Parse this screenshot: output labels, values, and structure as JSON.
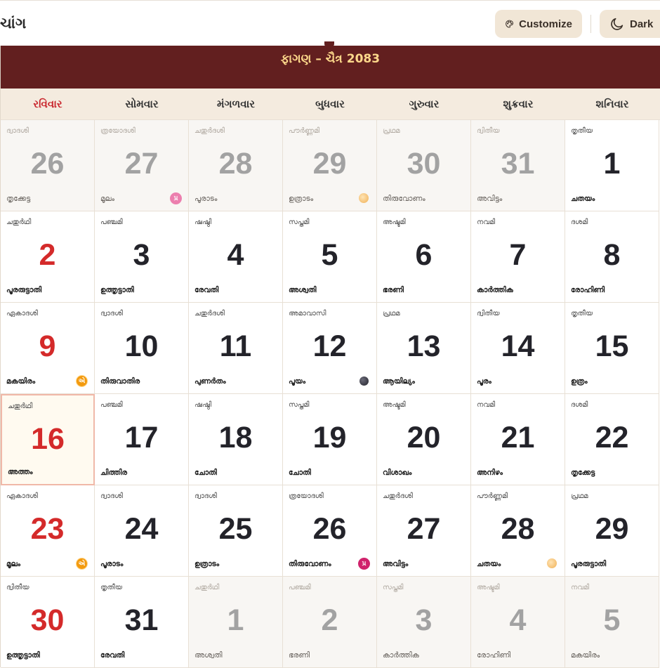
{
  "header": {
    "app_title": "ચાંગ",
    "customize_label": "Customize",
    "dark_label": "Dark",
    "customize_icon": "palette-icon",
    "dark_icon": "moon-icon"
  },
  "calendar": {
    "month_title": "ફાગણ – ચૈત્ર 2083",
    "weekdays": [
      "રવિવાર",
      "સોમવાર",
      "મંગળવાર",
      "બુધવાર",
      "ગુરુવાર",
      "શુક્રવાર",
      "શનિવાર"
    ],
    "days": [
      {
        "num": "26",
        "tithi": "ദ്വാദശി",
        "nak": "തൃക്കേട്ട",
        "muted": true
      },
      {
        "num": "27",
        "tithi": "ത്രയോദശി",
        "nak": "മൂലം",
        "muted": true,
        "marker": "badge-pink",
        "marker_text": "પ્ર"
      },
      {
        "num": "28",
        "tithi": "ചതുർദശി",
        "nak": "പൂരാടം",
        "muted": true
      },
      {
        "num": "29",
        "tithi": "പൗർണ്ണമി",
        "nak": "ഉത്രാടം",
        "muted": true,
        "marker": "full-moon"
      },
      {
        "num": "30",
        "tithi": "പ്രഥമ",
        "nak": "തിരുവോണം",
        "muted": true
      },
      {
        "num": "31",
        "tithi": "ദ്വിതീയ",
        "nak": "അവിട്ടം",
        "muted": true
      },
      {
        "num": "1",
        "tithi": "തൃതീയ",
        "nak": "ചതയം"
      },
      {
        "num": "2",
        "tithi": "ചതുർഥി",
        "nak": "പൂരരുട്ടാതി"
      },
      {
        "num": "3",
        "tithi": "പഞ്ചമി",
        "nak": "ഉത്തൃട്ടാതി"
      },
      {
        "num": "4",
        "tithi": "ഷഷ്ഠി",
        "nak": "രേവതി"
      },
      {
        "num": "5",
        "tithi": "സപ്തമി",
        "nak": "അശ്വതി"
      },
      {
        "num": "6",
        "tithi": "അഷ്ടമി",
        "nak": "ഭരണി"
      },
      {
        "num": "7",
        "tithi": "നവമി",
        "nak": "കാർത്തിക"
      },
      {
        "num": "8",
        "tithi": "ദശമി",
        "nak": "രോഹിണി"
      },
      {
        "num": "9",
        "tithi": "ഏകാദശി",
        "nak": "മകയിരം",
        "marker": "badge-orange",
        "marker_text": "એ"
      },
      {
        "num": "10",
        "tithi": "ദ്വാദശി",
        "nak": "തിരുവാതിര"
      },
      {
        "num": "11",
        "tithi": "ചതുർദശി",
        "nak": "പുണർതം"
      },
      {
        "num": "12",
        "tithi": "അമാവാസി",
        "nak": "പൂയം",
        "marker": "new-moon"
      },
      {
        "num": "13",
        "tithi": "പ്രഥമ",
        "nak": "ആയില്യം"
      },
      {
        "num": "14",
        "tithi": "ദ്വിതീയ",
        "nak": "പൂരം"
      },
      {
        "num": "15",
        "tithi": "തൃതീയ",
        "nak": "ഉത്രം"
      },
      {
        "num": "16",
        "tithi": "ചതുർഥി",
        "nak": "അത്തം",
        "today": true
      },
      {
        "num": "17",
        "tithi": "പഞ്ചമി",
        "nak": "ചിത്തിര"
      },
      {
        "num": "18",
        "tithi": "ഷഷ്ഠി",
        "nak": "ചോതി"
      },
      {
        "num": "19",
        "tithi": "സപ്തമി",
        "nak": "ചോതി"
      },
      {
        "num": "20",
        "tithi": "അഷ്ടമി",
        "nak": "വിശാഖം"
      },
      {
        "num": "21",
        "tithi": "നവമി",
        "nak": "അനിഴം"
      },
      {
        "num": "22",
        "tithi": "ദശമി",
        "nak": "തൃക്കേട്ട"
      },
      {
        "num": "23",
        "tithi": "ഏകാദശി",
        "nak": "മൂലം",
        "marker": "badge-orange",
        "marker_text": "એ"
      },
      {
        "num": "24",
        "tithi": "ദ്വാദശി",
        "nak": "പൂരാടം"
      },
      {
        "num": "25",
        "tithi": "ദ്വാദശി",
        "nak": "ഉത്രാടം"
      },
      {
        "num": "26",
        "tithi": "ത്രയോദശി",
        "nak": "തിരുവോണം",
        "marker": "badge-magenta",
        "marker_text": "પ્ર"
      },
      {
        "num": "27",
        "tithi": "ചതുർദശി",
        "nak": "അവിട്ടം"
      },
      {
        "num": "28",
        "tithi": "പൗർണ്ണമി",
        "nak": "ചതയം",
        "marker": "full-moon"
      },
      {
        "num": "29",
        "tithi": "പ്രഥമ",
        "nak": "പൂരരുട്ടാതി"
      },
      {
        "num": "30",
        "tithi": "ദ്വിതീയ",
        "nak": "ഉത്തൃട്ടാതി"
      },
      {
        "num": "31",
        "tithi": "തൃതീയ",
        "nak": "രേവതി"
      },
      {
        "num": "1",
        "tithi": "ചതുർഥി",
        "nak": "അശ്വതി",
        "muted": true
      },
      {
        "num": "2",
        "tithi": "പഞ്ചമി",
        "nak": "ഭരണി",
        "muted": true
      },
      {
        "num": "3",
        "tithi": "സപ്തമി",
        "nak": "കാർത്തിക",
        "muted": true
      },
      {
        "num": "4",
        "tithi": "അഷ്ടമി",
        "nak": "രോഹിണി",
        "muted": true
      },
      {
        "num": "5",
        "tithi": "നവമി",
        "nak": "മകയിരം",
        "muted": true
      }
    ]
  }
}
